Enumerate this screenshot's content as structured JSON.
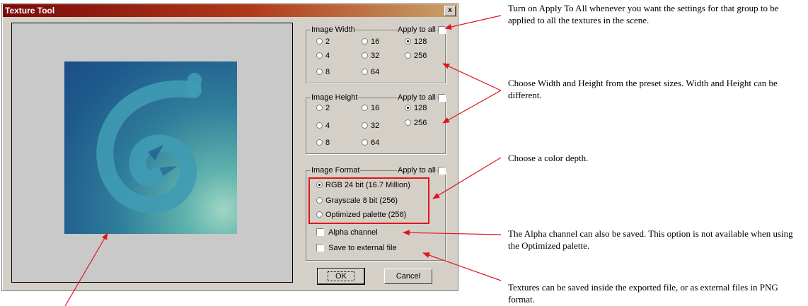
{
  "dialog": {
    "title": "Texture Tool",
    "close_label": "x",
    "ok_label": "OK",
    "cancel_label": "Cancel"
  },
  "image_width": {
    "label": "Image Width",
    "apply_label": "Apply to all",
    "options": [
      "2",
      "4",
      "8",
      "16",
      "32",
      "64",
      "128",
      "256"
    ],
    "selected": "128"
  },
  "image_height": {
    "label": "Image Height",
    "apply_label": "Apply to all",
    "options": [
      "2",
      "4",
      "8",
      "16",
      "32",
      "64",
      "128",
      "256"
    ],
    "selected": "128"
  },
  "image_format": {
    "label": "Image Format",
    "apply_label": "Apply to all",
    "options": [
      "RGB 24 bit (16.7 Million)",
      "Grayscale 8 bit (256)",
      "Optimized palette (256)"
    ],
    "selected": "RGB 24 bit (16.7 Million)",
    "alpha_label": "Alpha channel",
    "external_label": "Save to external file"
  },
  "annotations": {
    "apply_all": "Turn on Apply To All whenever you want the settings for that group to be applied to all the textures in the scene.",
    "width_height": "Choose Width and Height from the preset sizes. Width and Height can be different.",
    "color_depth": "Choose a color depth.",
    "alpha": "The Alpha channel can also be saved. This option is not available when using the Optimized palette.",
    "external": "Textures can be saved inside the exported file, or as external files in PNG format."
  },
  "colors": {
    "accent_red": "#e0141e",
    "title_bar": "#7b0a0a",
    "dialog_bg": "#d4d0c8"
  }
}
